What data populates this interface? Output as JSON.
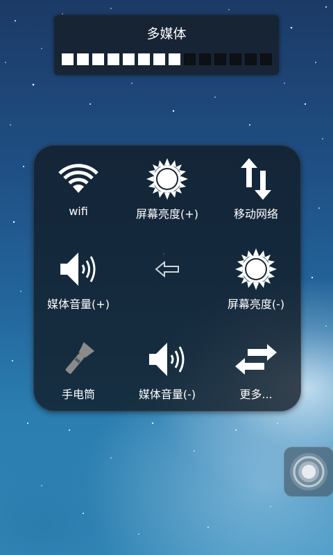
{
  "toast": {
    "title": "多媒体",
    "volume_level": 8,
    "volume_max": 14
  },
  "panel": {
    "items": [
      {
        "label": "wifi",
        "icon": "wifi-icon"
      },
      {
        "label": "屏幕亮度(+)",
        "icon": "brightness-up-icon"
      },
      {
        "label": "移动网络",
        "icon": "mobile-data-icon"
      },
      {
        "label": "媒体音量(+)",
        "icon": "volume-up-icon"
      },
      {
        "label": "",
        "icon": "back-arrow-icon"
      },
      {
        "label": "屏幕亮度(-)",
        "icon": "brightness-down-icon"
      },
      {
        "label": "手电筒",
        "icon": "flashlight-icon"
      },
      {
        "label": "媒体音量(-)",
        "icon": "volume-down-icon"
      },
      {
        "label": "更多...",
        "icon": "more-swap-icon"
      }
    ]
  },
  "floating_button": {
    "icon": "assistive-touch-icon"
  },
  "colors": {
    "panel_bg": "#121c26",
    "icon": "#ffffff",
    "flashlight": "#8a8a8a",
    "back_arrow": "#cfd6dc"
  }
}
